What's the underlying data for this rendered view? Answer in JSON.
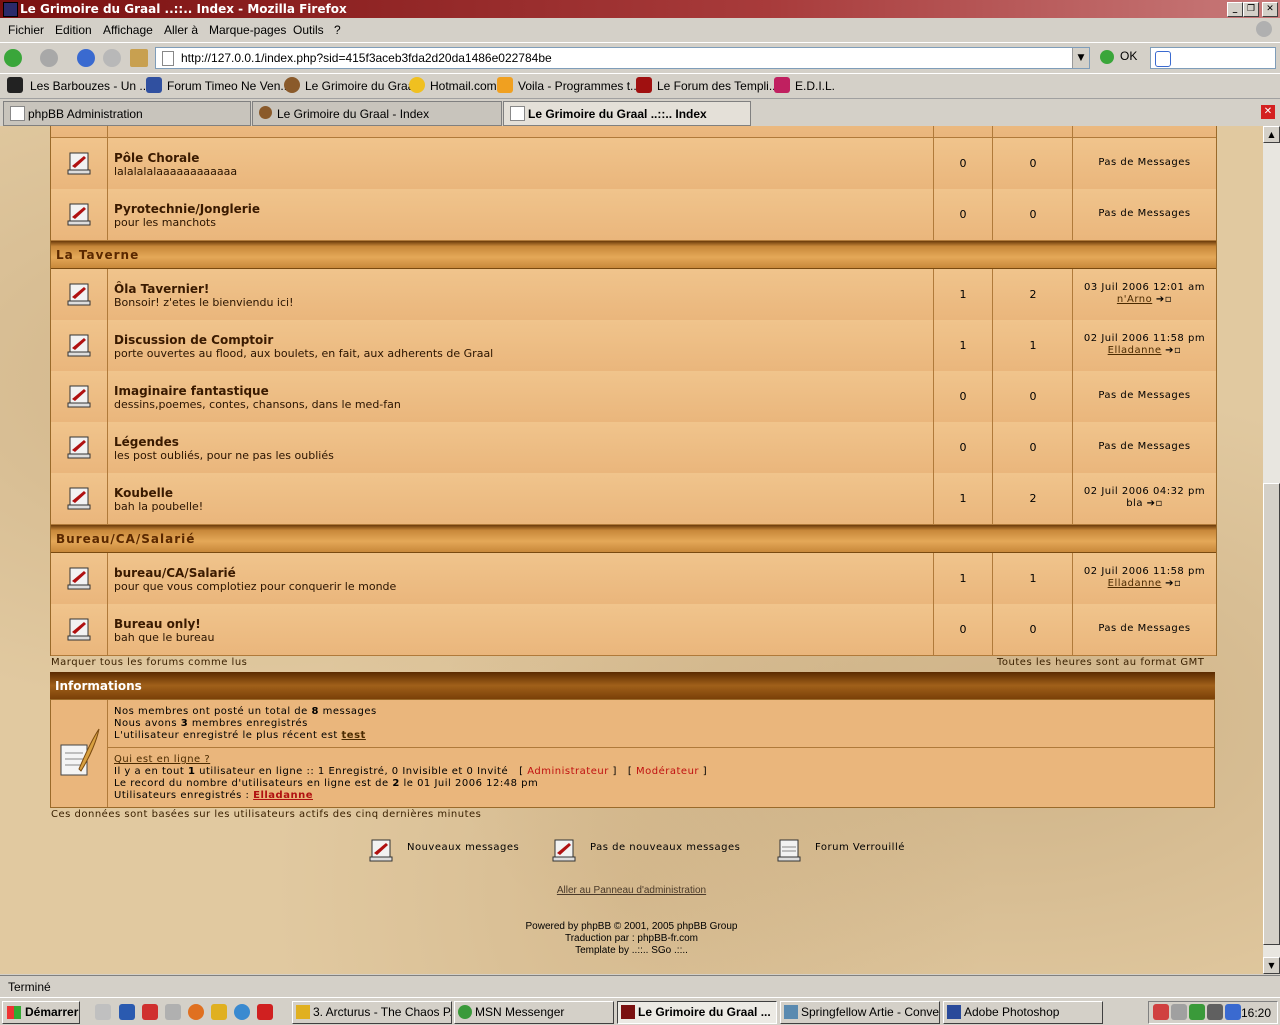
{
  "window": {
    "title": "Le Grimoire du Graal ..::.. Index - Mozilla Firefox"
  },
  "menu": [
    "Fichier",
    "Edition",
    "Affichage",
    "Aller à",
    "Marque-pages",
    "Outils",
    "?"
  ],
  "nav": {
    "url": "http://127.0.0.1/index.php?sid=415f3aceb3fda2d20da1486e022784be",
    "go_label": "OK"
  },
  "bookmarks": [
    "Les Barbouzes - Un ...",
    "Forum Timeo Ne Ven...",
    "Le Grimoire du Graal",
    "Hotmail.com",
    "Voila - Programmes t...",
    "Le Forum des Templi...",
    "E.D.I.L."
  ],
  "tabs": [
    "phpBB Administration",
    "Le Grimoire du Graal - Index",
    "Le Grimoire du Graal ..::.. Index"
  ],
  "forums_top": [
    {
      "name": "Pôle Chorale",
      "desc": "lalalalalaaaaaaaaaaaa",
      "topics": "0",
      "posts": "0",
      "last": "Pas de Messages"
    },
    {
      "name": "Pyrotechnie/Jonglerie",
      "desc": "pour les manchots",
      "topics": "0",
      "posts": "0",
      "last": "Pas de Messages"
    }
  ],
  "cat_taverne": "La Taverne",
  "forums_taverne": [
    {
      "name": "Ôla Tavernier!",
      "desc": "Bonsoir! z'etes le bienviendu ici!",
      "topics": "1",
      "posts": "2",
      "date": "03 Juil 2006 12:01 am",
      "user": "n'Arno"
    },
    {
      "name": "Discussion de Comptoir",
      "desc": "porte ouvertes au flood, aux boulets, en fait, aux adherents de Graal",
      "topics": "1",
      "posts": "1",
      "date": "02 Juil 2006 11:58 pm",
      "user": "Elladanne"
    },
    {
      "name": "Imaginaire fantastique",
      "desc": "dessins,poemes, contes, chansons, dans le med-fan",
      "topics": "0",
      "posts": "0",
      "last": "Pas de Messages"
    },
    {
      "name": "Légendes",
      "desc": "les post oubliés, pour ne pas les oubliés",
      "topics": "0",
      "posts": "0",
      "last": "Pas de Messages"
    },
    {
      "name": "Koubelle",
      "desc": "bah la poubelle!",
      "topics": "1",
      "posts": "2",
      "date": "02 Juil 2006 04:32 pm",
      "user": "bla"
    }
  ],
  "cat_bureau": "Bureau/CA/Salarié",
  "forums_bureau": [
    {
      "name": "bureau/CA/Salarié",
      "desc": "pour que vous complotiez pour conquerir le monde",
      "topics": "1",
      "posts": "1",
      "date": "02 Juil 2006 11:58 pm",
      "user": "Elladanne"
    },
    {
      "name": "Bureau only!",
      "desc": "bah que le bureau",
      "topics": "0",
      "posts": "0",
      "last": "Pas de Messages"
    }
  ],
  "mark_all": "Marquer tous les forums comme lus",
  "timezone": "Toutes les heures sont au format GMT",
  "info": {
    "title": "Informations",
    "l1a": "Nos membres ont posté un total de ",
    "l1b": "8",
    "l1c": " messages",
    "l2a": "Nous avons ",
    "l2b": "3",
    "l2c": " membres enregistrés",
    "l3a": "L'utilisateur enregistré le plus récent est ",
    "l3b": "test",
    "who": "Qui est en ligne ?",
    "l4a": "Il y a en tout ",
    "l4b": "1",
    "l4c": " utilisateur en ligne :: 1 Enregistré, 0 Invisible et 0 Invité",
    "admin": "Administrateur",
    "mod": "Modérateur",
    "l5a": "Le record du nombre d'utilisateurs en ligne est de ",
    "l5b": "2",
    "l5c": " le 01 Juil 2006 12:48 pm",
    "l6a": "Utilisateurs enregistrés : ",
    "l6b": "Elladanne",
    "note": "Ces données sont basées sur les utilisateurs actifs des cinq dernières minutes"
  },
  "legend": {
    "new": "Nouveaux messages",
    "nonew": "Pas de nouveaux messages",
    "locked": "Forum Verrouillé"
  },
  "footer": {
    "admin_link": "Aller au Panneau d'administration",
    "powered": "Powered by phpBB © 2001, 2005 phpBB Group",
    "trad": "Traduction par : phpBB-fr.com",
    "template": "Template by ..::.. SGo .::.."
  },
  "status": "Terminé",
  "taskbar": {
    "start": "Démarrer",
    "tasks": [
      "3. Arcturus - The Chaos P...",
      "MSN Messenger",
      "Le Grimoire du Graal ...",
      "Springfellow Artie - Conver...",
      "Adobe Photoshop"
    ],
    "clock": "16:20"
  }
}
